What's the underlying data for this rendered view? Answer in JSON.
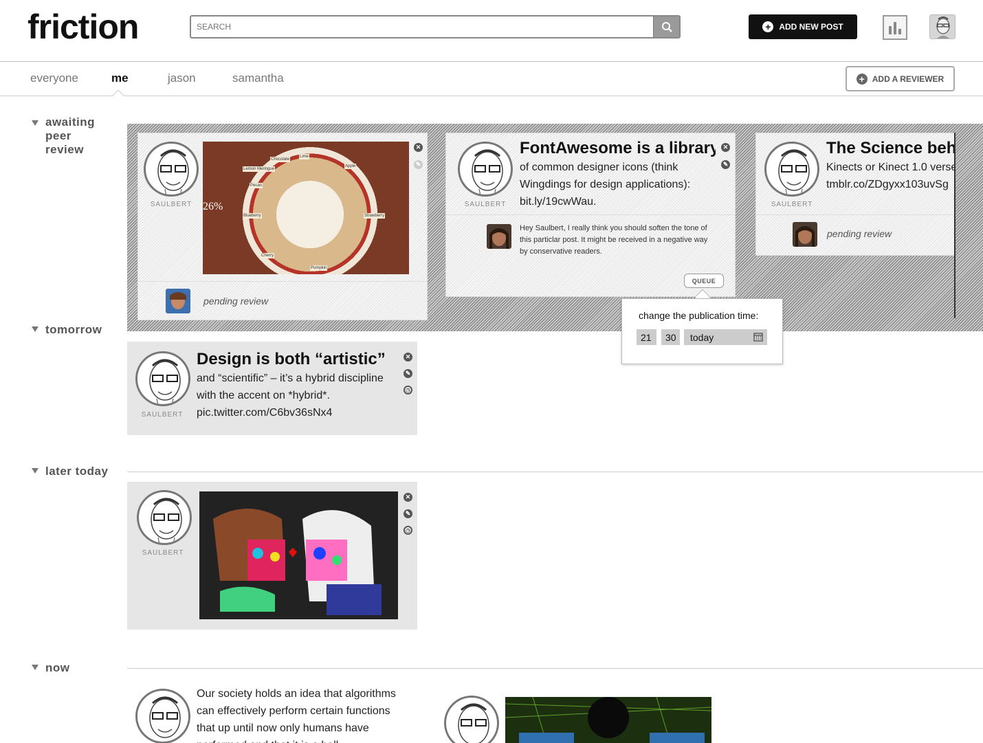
{
  "header": {
    "logo": "friction",
    "search_placeholder": "SEARCH",
    "add_post_label": "ADD NEW POST"
  },
  "tabs": [
    {
      "label": "everyone",
      "active": false
    },
    {
      "label": "me",
      "active": true
    },
    {
      "label": "jason",
      "active": false
    },
    {
      "label": "samantha",
      "active": false
    }
  ],
  "add_reviewer_label": "ADD A REVIEWER",
  "sections": {
    "awaiting": "awaiting peer review",
    "tomorrow": "tomorrow",
    "later_today": "later today",
    "now": "now"
  },
  "author": "SAULBERT",
  "review_cards": [
    {
      "image_labels": [
        "26%",
        "Chocolate",
        "Cherry",
        "Pecan",
        "Apple",
        "Strawberry",
        "Lemon Meringue",
        "Blueberry",
        "Pumpkin",
        "Lime"
      ],
      "status": "pending review"
    },
    {
      "title": "FontAwesome is a library",
      "body": "of common designer icons (think Wingdings for design applications): bit.ly/19cwWau.",
      "comment": "Hey Saulbert, I really think you should soften the tone of this particlar post. It might be received in a negative way by conservative readers.",
      "queue_label": "QUEUE"
    },
    {
      "title": "The Science behi",
      "body": "Kinects or Kinect 1.0 verse tmblr.co/ZDgyxx103uvSg",
      "status": "pending review"
    }
  ],
  "popup": {
    "title": "change the publication time:",
    "hour": "21",
    "minute": "30",
    "day": "today"
  },
  "tomorrow_card": {
    "title": "Design is both “artistic”",
    "body": "and “scientific” – it’s a hybrid discipline with the accent on *hybrid*. pic.twitter.com/C6bv36sNx4"
  },
  "now_card": {
    "body": "Our society holds an idea that algorithms can effectively perform certain functions that up until now only humans have performed and that it is a ball"
  },
  "colors": {
    "primary_button": "#111111",
    "hatch_dark": "#7a7a7a",
    "card_grey": "#e6e6e6"
  }
}
